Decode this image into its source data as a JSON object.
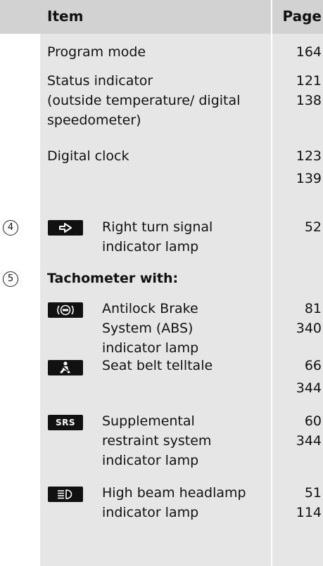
{
  "header": {
    "item_label": "Item",
    "page_label": "Page"
  },
  "rows": [
    {
      "text": "Program mode",
      "page": "164"
    },
    {
      "text_lines": [
        "Status indicator",
        "(outside temperature/ digital",
        "speedometer)"
      ],
      "pages": [
        "121",
        "138"
      ]
    },
    {
      "text": "Digital clock",
      "pages": [
        "123",
        "139"
      ]
    },
    {
      "marker": "4",
      "icon": "right-turn-signal-icon",
      "text_lines": [
        "Right turn signal",
        "indicator lamp"
      ],
      "page": "52"
    },
    {
      "marker": "5",
      "text": "Tachometer with:"
    },
    {
      "icon": "abs-icon",
      "text_lines": [
        "Antilock Brake",
        "System (ABS)",
        "indicator lamp"
      ],
      "pages": [
        "81",
        "340"
      ]
    },
    {
      "icon": "seat-belt-icon",
      "text": "Seat belt telltale",
      "pages": [
        "66",
        "344"
      ]
    },
    {
      "icon": "srs-icon",
      "icon_text": "SRS",
      "text_lines": [
        "Supplemental",
        "restraint system",
        "indicator lamp"
      ],
      "pages": [
        "60",
        "344"
      ]
    },
    {
      "icon": "high-beam-icon",
      "text_lines": [
        "High beam headlamp",
        "indicator lamp"
      ],
      "pages": [
        "51",
        "114"
      ]
    }
  ]
}
